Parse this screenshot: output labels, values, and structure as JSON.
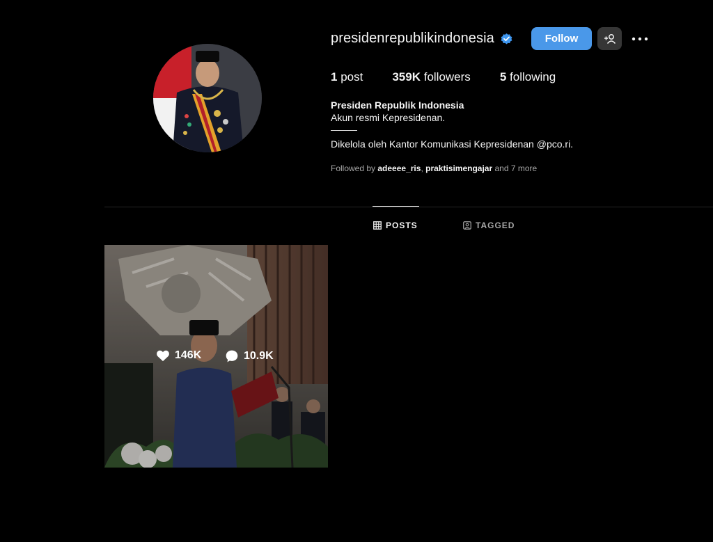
{
  "profile": {
    "username": "presidenrepublikindonesia",
    "verified_icon": "verified-badge-icon",
    "follow_label": "Follow",
    "suggest_icon": "add-person-icon",
    "more_icon": "more-options-icon",
    "accent_color": "#4a98e9"
  },
  "stats": {
    "posts_count": "1",
    "posts_label": "post",
    "followers_count": "359K",
    "followers_label": "followers",
    "following_count": "5",
    "following_label": "following"
  },
  "bio": {
    "full_name": "Presiden Republik Indonesia",
    "line1": "Akun resmi Kepresidenan.",
    "line2": "Dikelola oleh Kantor Komunikasi Kepresidenan @pco.ri."
  },
  "followed_by": {
    "prefix": "Followed by ",
    "user1": "adeeee_ris",
    "separator": ", ",
    "user2": "praktisimengajar",
    "suffix": " and 7 more"
  },
  "tabs": [
    {
      "label": "POSTS",
      "icon": "grid-icon",
      "active": true
    },
    {
      "label": "TAGGED",
      "icon": "tagged-icon",
      "active": false
    }
  ],
  "posts": [
    {
      "likes": "146K",
      "comments": "10.9K"
    }
  ]
}
